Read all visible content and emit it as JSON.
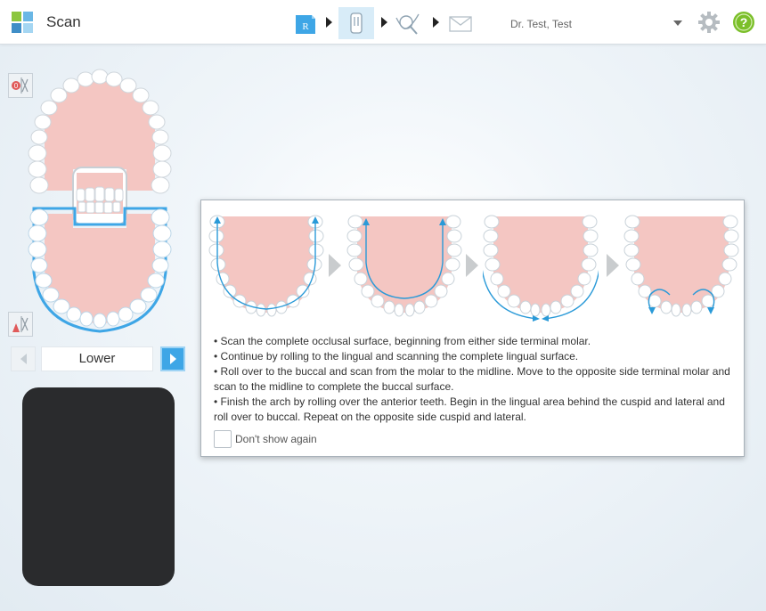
{
  "app": {
    "title": "Scan",
    "logo_icon": "grid-logo-icon"
  },
  "workflow": {
    "steps": [
      {
        "name": "rx",
        "icon": "rx-form-icon",
        "label": "R"
      },
      {
        "name": "scan",
        "icon": "scanner-wand-icon",
        "active": true
      },
      {
        "name": "view",
        "icon": "view-magnifier-icon"
      },
      {
        "name": "send",
        "icon": "envelope-icon"
      }
    ]
  },
  "user": {
    "name": "Dr. Test, Test"
  },
  "jaw_nav": {
    "label": "Lower"
  },
  "dialog": {
    "instructions": [
      "• Scan the complete occlusal surface, beginning from either side terminal molar.",
      "• Continue by rolling to the lingual and scanning the complete lingual surface.",
      "• Roll over to the buccal and scan from the molar to the midline.  Move to the opposite side terminal molar and scan to the midline to complete the buccal surface.",
      "• Finish the arch by rolling over the anterior teeth.  Begin in the lingual area behind the cuspid and lateral and roll over to buccal.  Repeat on the opposite side cuspid and lateral."
    ],
    "dont_show_label": "Don't show again",
    "dont_show_checked": false
  },
  "colors": {
    "accent": "#3ea6e6",
    "gum": "#f4c6c2",
    "tooth": "#ffffff",
    "scan_path": "#2a9ad8",
    "help": "#7bbf2a"
  }
}
